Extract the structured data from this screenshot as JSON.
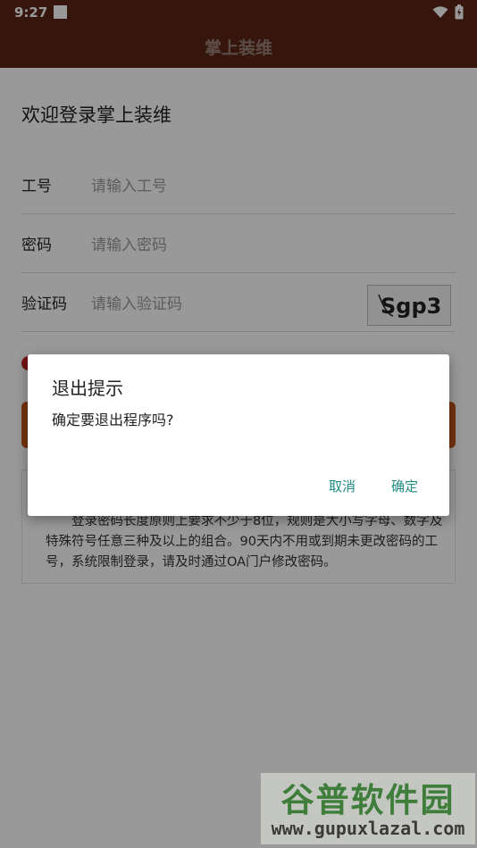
{
  "status_bar": {
    "time": "9:27"
  },
  "app_bar": {
    "title": "掌上装维"
  },
  "login": {
    "welcome": "欢迎登录掌上装维",
    "fields": [
      {
        "label": "工号",
        "placeholder": "请输入工号"
      },
      {
        "label": "密码",
        "placeholder": "请输入密码"
      },
      {
        "label": "验证码",
        "placeholder": "请输入验证码"
      }
    ],
    "captcha_text": "Sgp3",
    "notice": "登录密码长度原则上要求不少于8位，规则是大小写字母、数字及特殊符号任意三种及以上的组合。90天内不用或到期未更改密码的工号，系统限制登录，请及时通过OA门户修改密码。"
  },
  "dialog": {
    "title": "退出提示",
    "message": "确定要退出程序吗?",
    "cancel_label": "取消",
    "ok_label": "确定"
  },
  "watermark": {
    "title": "谷普软件园",
    "url": "www.gupuxlazal.com"
  },
  "colors": {
    "app_bar": "#5a2614",
    "accent_button": "#1f8a80",
    "login_button": "#c4561a"
  }
}
